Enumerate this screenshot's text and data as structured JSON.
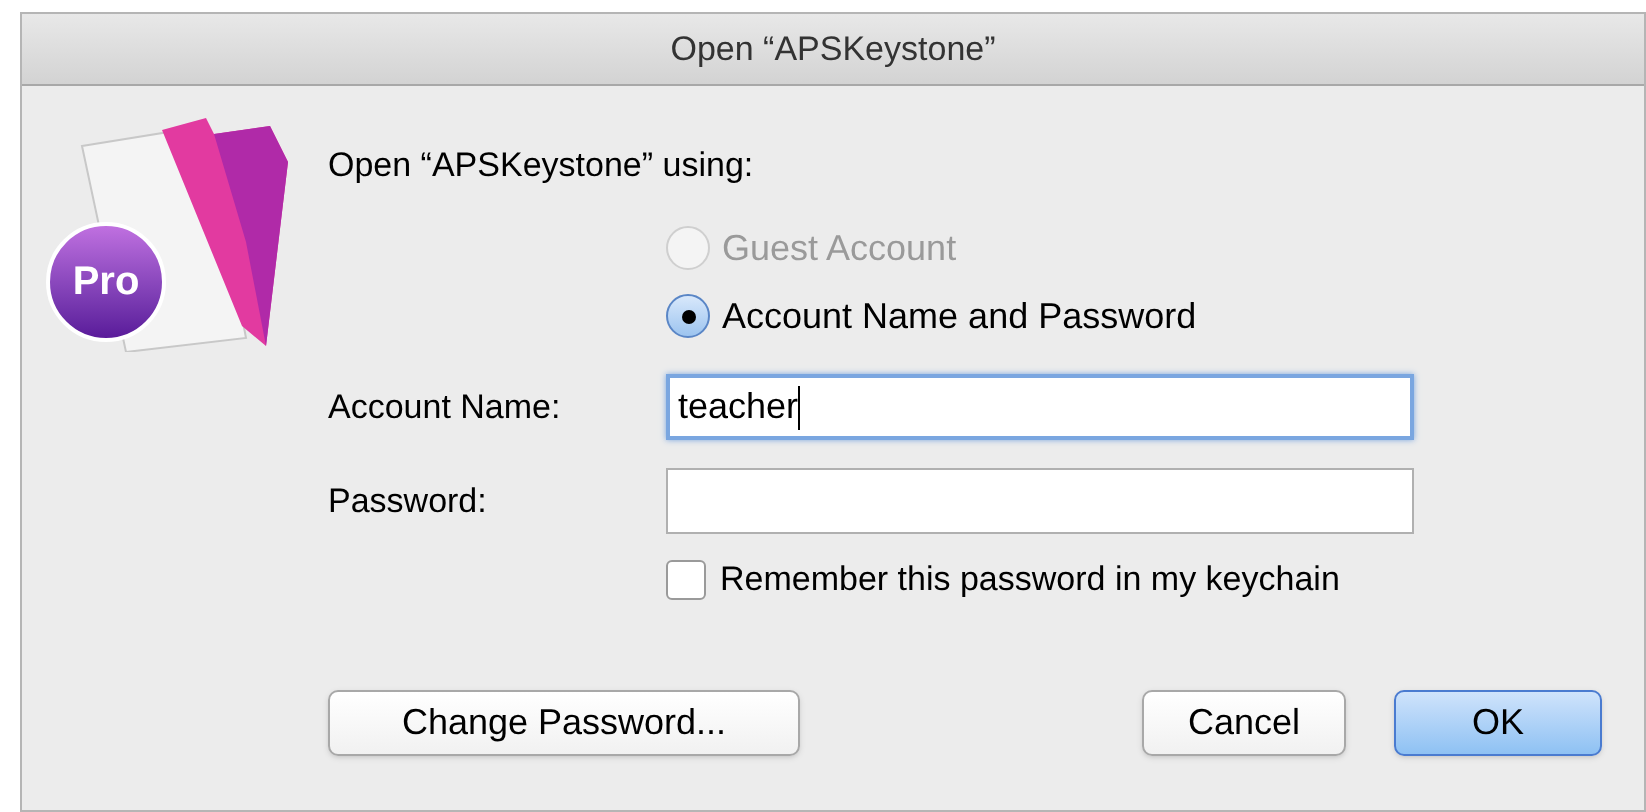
{
  "window": {
    "title": "Open “APSKeystone”"
  },
  "app_icon": {
    "badge": "Pro"
  },
  "heading": "Open “APSKeystone” using:",
  "login_options": [
    {
      "label": "Guest Account",
      "selected": false,
      "disabled": true
    },
    {
      "label": "Account Name and Password",
      "selected": true,
      "disabled": false
    }
  ],
  "fields": [
    {
      "label": "Account Name:",
      "value": "teacher",
      "focused": true
    },
    {
      "label": "Password:",
      "focused": false
    }
  ],
  "remember": {
    "label": "Remember this password in my keychain",
    "checked": false
  },
  "buttons": [
    {
      "label": "Change Password...",
      "default": false
    },
    {
      "label": "Cancel",
      "default": false
    },
    {
      "label": "OK",
      "default": true
    }
  ]
}
